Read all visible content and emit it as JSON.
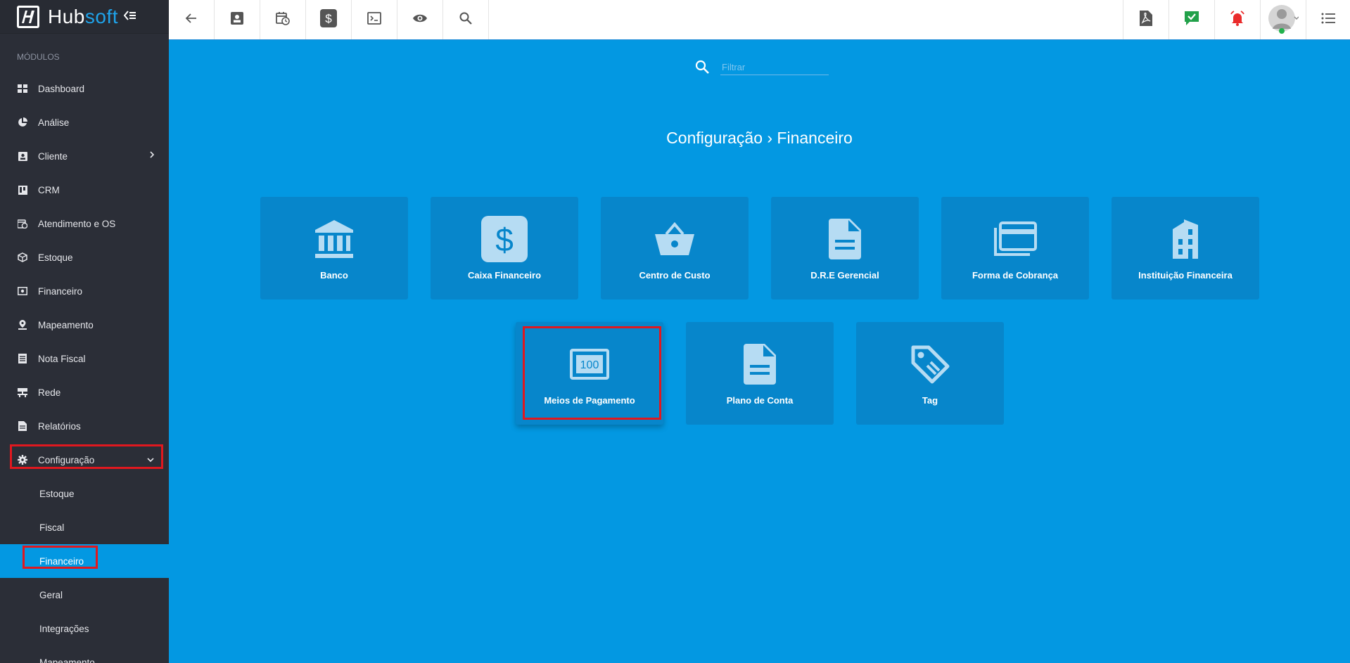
{
  "brand": {
    "name_a": "Hub",
    "name_b": "soft",
    "collapse_icon": "menu-collapse-icon"
  },
  "sidebar": {
    "section_label": "MÓDULOS",
    "items": [
      {
        "label": "Dashboard",
        "icon": "dashboard-icon"
      },
      {
        "label": "Análise",
        "icon": "pie-chart-icon"
      },
      {
        "label": "Cliente",
        "icon": "contact-card-icon"
      },
      {
        "label": "CRM",
        "icon": "kanban-icon"
      },
      {
        "label": "Atendimento e OS",
        "icon": "calendar-clock-icon"
      },
      {
        "label": "Estoque",
        "icon": "box-icon"
      },
      {
        "label": "Financeiro",
        "icon": "money-icon"
      },
      {
        "label": "Mapeamento",
        "icon": "map-pin-icon"
      },
      {
        "label": "Nota Fiscal",
        "icon": "receipt-icon"
      },
      {
        "label": "Rede",
        "icon": "network-icon"
      },
      {
        "label": "Relatórios",
        "icon": "report-icon"
      },
      {
        "label": "Configuração",
        "icon": "gear-icon"
      }
    ],
    "sub_items": [
      {
        "label": "Estoque"
      },
      {
        "label": "Fiscal"
      },
      {
        "label": "Financeiro"
      },
      {
        "label": "Geral"
      },
      {
        "label": "Integrações"
      },
      {
        "label": "Mapeamento"
      }
    ]
  },
  "topbar": {
    "left_icons": [
      "back-arrow-icon",
      "contact-card-icon",
      "calendar-clock-icon",
      "dollar-icon",
      "terminal-icon",
      "eye-icon",
      "search-icon"
    ],
    "right_icons": [
      "pdf-icon",
      "task-check-icon",
      "alarm-bell-icon",
      "user-avatar",
      "list-menu-icon"
    ]
  },
  "main": {
    "filter_placeholder": "Filtrar",
    "breadcrumb": "Configuração › Financeiro",
    "tiles": [
      {
        "label": "Banco",
        "icon": "bank-icon"
      },
      {
        "label": "Caixa Financeiro",
        "icon": "dollar-box-icon"
      },
      {
        "label": "Centro de Custo",
        "icon": "basket-icon"
      },
      {
        "label": "D.R.E Gerencial",
        "icon": "document-icon"
      },
      {
        "label": "Forma de Cobrança",
        "icon": "cards-icon"
      },
      {
        "label": "Instituição Financeira",
        "icon": "building-icon"
      },
      {
        "label": "Meios de Pagamento",
        "icon": "banknote-100-icon",
        "banknote_text": "100"
      },
      {
        "label": "Plano de Conta",
        "icon": "document-icon"
      },
      {
        "label": "Tag",
        "icon": "tag-icon"
      }
    ]
  },
  "colors": {
    "sidebar": "#2b2e37",
    "main_bg": "#0398e2",
    "tile": "#0786cb",
    "highlight": "#e0181f"
  }
}
